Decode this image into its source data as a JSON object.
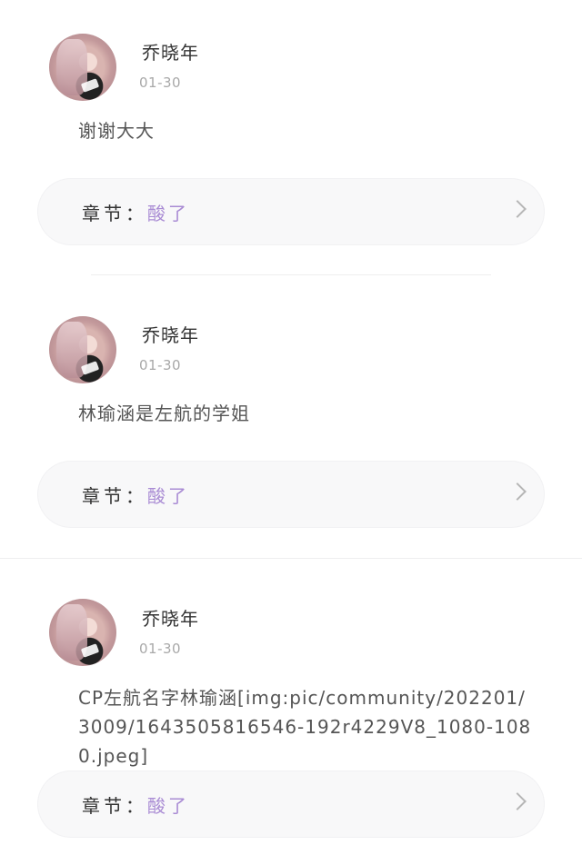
{
  "comments": [
    {
      "username": "乔晓年",
      "date": "01-30",
      "content": "谢谢大大",
      "chapter_label": "章节：",
      "chapter_name": "酸了"
    },
    {
      "username": "乔晓年",
      "date": "01-30",
      "content": "林瑜涵是左航的学姐",
      "chapter_label": "章节：",
      "chapter_name": "酸了"
    },
    {
      "username": "乔晓年",
      "date": "01-30",
      "content": "CP左航名字林瑜涵[img:pic/community/202201/3009/1643505816546-192r4229V8_1080-1080.jpeg]",
      "chapter_label": "章节：",
      "chapter_name": "酸了"
    }
  ],
  "icons": {
    "chevron": "chevron-right-icon",
    "avatar": "user-avatar"
  },
  "colors": {
    "chapter_accent": "#a98bd4",
    "date": "#a8a8a8",
    "card_bg": "#f8f8f9"
  }
}
